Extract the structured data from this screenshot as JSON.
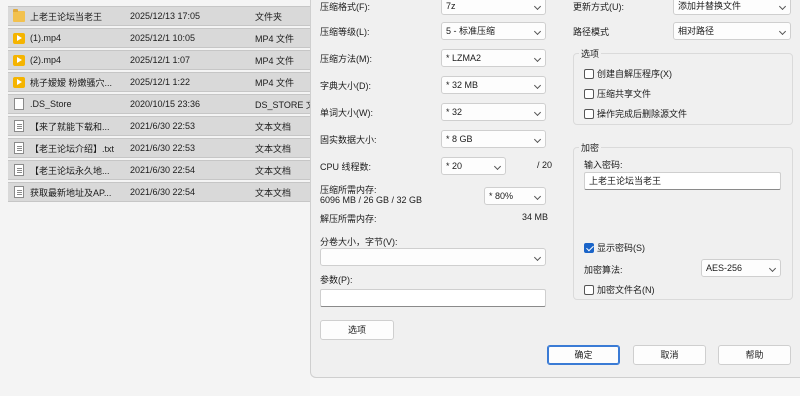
{
  "files": [
    {
      "name": "上老王论坛当老王",
      "date": "2025/12/13 17:05",
      "type": "文件夹",
      "icon": "folder-icon"
    },
    {
      "name": "(1).mp4",
      "date": "2025/12/1 10:05",
      "type": "MP4 文件",
      "icon": "video-icon"
    },
    {
      "name": "(2).mp4",
      "date": "2025/12/1 1:07",
      "type": "MP4 文件",
      "icon": "video-icon"
    },
    {
      "name": "桃子嫒嫒 粉嫩骚穴...",
      "date": "2025/12/1 1:22",
      "type": "MP4 文件",
      "icon": "video-icon"
    },
    {
      "name": ".DS_Store",
      "date": "2020/10/15 23:36",
      "type": "DS_STORE 文",
      "icon": "file-icon"
    },
    {
      "name": "【来了就能下载和...",
      "date": "2021/6/30 22:53",
      "type": "文本文档",
      "icon": "text-doc-icon"
    },
    {
      "name": "【老王论坛介绍】.txt",
      "date": "2021/6/30 22:53",
      "type": "文本文档",
      "icon": "text-doc-icon"
    },
    {
      "name": "【老王论坛永久地...",
      "date": "2021/6/30 22:54",
      "type": "文本文档",
      "icon": "text-doc-icon"
    },
    {
      "name": "获取最新地址及AP...",
      "date": "2021/6/30 22:54",
      "type": "文本文档",
      "icon": "text-doc-icon"
    }
  ],
  "dialog": {
    "format_label": "压缩格式(F):",
    "format_value": "7z",
    "level_label": "压缩等级(L):",
    "level_value": "5 - 标准压缩",
    "method_label": "压缩方法(M):",
    "method_value": "* LZMA2",
    "dict_label": "字典大小(D):",
    "dict_value": "* 32 MB",
    "word_label": "单词大小(W):",
    "word_value": "* 32",
    "solid_label": "固实数据大小:",
    "solid_value": "* 8 GB",
    "cpu_label": "CPU 线程数:",
    "cpu_value": "* 20",
    "cpu_max": "/ 20",
    "mem_comp_label": "压缩所需内存:",
    "mem_comp_detail": "6096 MB / 26 GB / 32 GB",
    "mem_comp_percent": "* 80%",
    "mem_decomp_label": "解压所需内存:",
    "mem_decomp_value": "34 MB",
    "split_label": "分卷大小，字节(V):",
    "split_value": "",
    "params_label": "参数(P):",
    "params_value": "",
    "options_button": "选项",
    "update_label": "更新方式(U):",
    "update_value": "添加并替换文件",
    "path_label": "路径模式",
    "path_value": "相对路径",
    "options_group": "选项",
    "opt_sfx": "创建自解压程序(X)",
    "opt_shared": "压缩共享文件",
    "opt_delete": "操作完成后删除源文件",
    "enc_group": "加密",
    "password_label": "输入密码:",
    "password_value": "上老王论坛当老王",
    "show_password": "显示密码(S)",
    "enc_method_label": "加密算法:",
    "enc_method_value": "AES-256",
    "enc_names": "加密文件名(N)",
    "ok_button": "确定",
    "cancel_button": "取消",
    "help_button": "帮助"
  },
  "colors": {
    "accent": "#1a64c8",
    "row_selected": "#d9d9d9",
    "folder": "#f2c14e",
    "video": "#f5b400"
  }
}
